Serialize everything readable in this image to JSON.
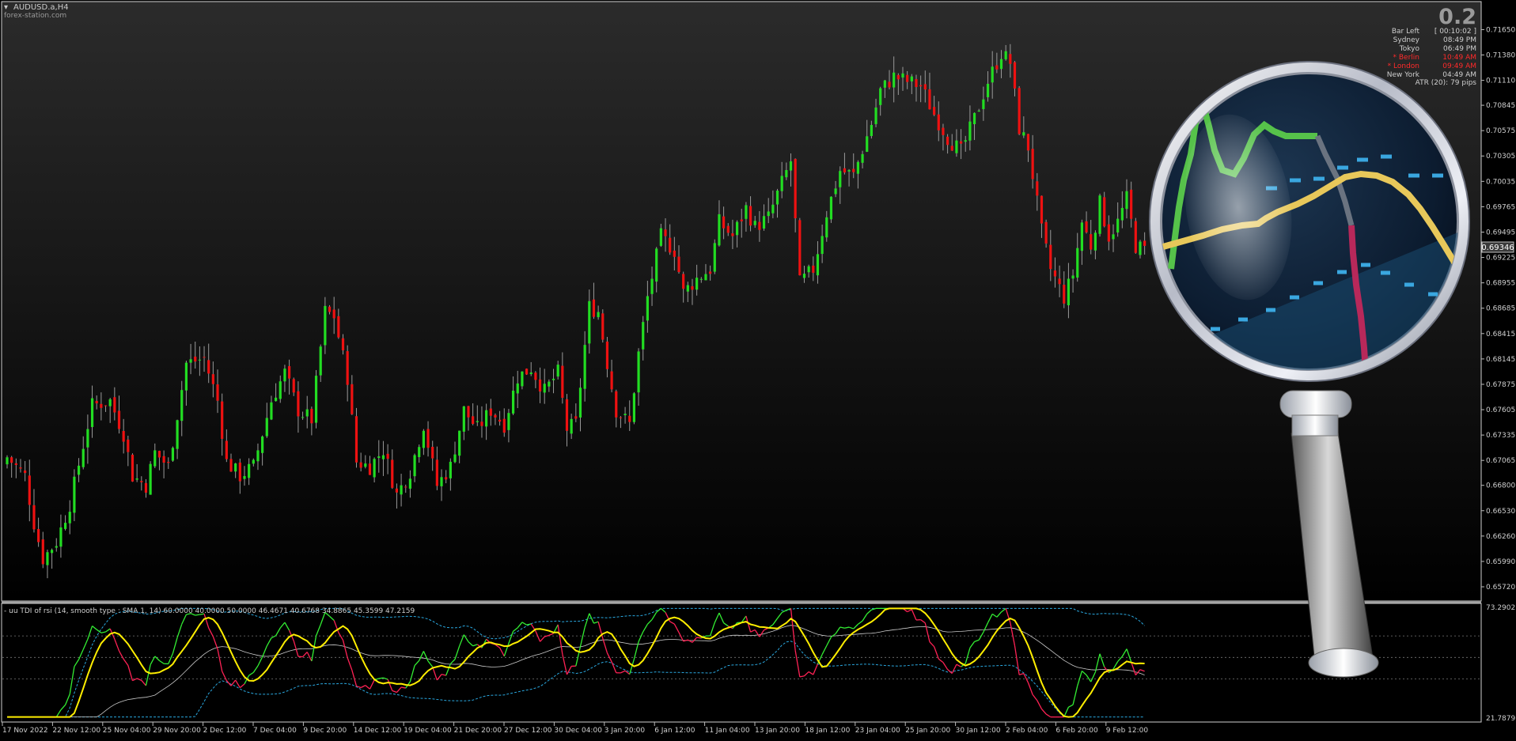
{
  "window": {
    "title": "AUDUSD.a,H4",
    "watermark": "forex-station.com"
  },
  "info_panel": {
    "spread": "0.2",
    "rows": [
      {
        "label": "Bar Left",
        "value": "[ 00:10:02 ]",
        "highlight": false
      },
      {
        "label": "Sydney",
        "value": "08:49 PM",
        "highlight": false
      },
      {
        "label": "Tokyo",
        "value": "06:49 PM",
        "highlight": false
      },
      {
        "label": "* Berlin",
        "value": "10:49 AM",
        "highlight": true
      },
      {
        "label": "* London",
        "value": "09:49 AM",
        "highlight": true
      },
      {
        "label": "New York",
        "value": "04:49 AM",
        "highlight": false
      }
    ],
    "atr": "ATR (20): 79 pips"
  },
  "indicator_header": "- uu TDI of rsi  (14, smooth type :  SMA 1, 14) 60.0000 40.0000 50.0000 46.4671 40.6768 34.8865 45.3599 47.2159",
  "colors": {
    "bull": "#22dd22",
    "bear": "#ee1111",
    "wick": "#9a9a9a",
    "tdi_yellow": "#ffee00",
    "tdi_band": "#2aa8e0",
    "tdi_green": "#33ee33",
    "tdi_red": "#ff2255",
    "tdi_white": "#cccccc"
  },
  "chart_data": [
    {
      "type": "candlestick",
      "symbol": "AUDUSD.a",
      "timeframe": "H4",
      "ylim": [
        0.6572,
        0.7178
      ],
      "current_price": "0.69346",
      "y_ticks": [
        "0.71650",
        "0.71380",
        "0.71110",
        "0.70845",
        "0.70575",
        "0.70305",
        "0.70035",
        "0.69765",
        "0.69495",
        "0.69225",
        "0.68955",
        "0.68685",
        "0.68415",
        "0.68145",
        "0.67875",
        "0.67605",
        "0.67335",
        "0.67065",
        "0.66800",
        "0.66530",
        "0.66260",
        "0.65990",
        "0.65720"
      ],
      "x_ticks": [
        "17 Nov 2022",
        "22 Nov 12:00",
        "25 Nov 04:00",
        "29 Nov 20:00",
        "2 Dec 12:00",
        "7 Dec 04:00",
        "9 Dec 20:00",
        "14 Dec 12:00",
        "19 Dec 04:00",
        "21 Dec 20:00",
        "27 Dec 12:00",
        "30 Dec 04:00",
        "3 Jan 20:00",
        "6 Jan 12:00",
        "11 Jan 04:00",
        "13 Jan 20:00",
        "18 Jan 12:00",
        "23 Jan 04:00",
        "25 Jan 20:00",
        "30 Jan 12:00",
        "2 Feb 04:00",
        "6 Feb 20:00",
        "9 Feb 12:00"
      ],
      "close_path": [
        [
          0,
          0.671
        ],
        [
          4,
          0.669
        ],
        [
          6,
          0.664
        ],
        [
          8,
          0.6602
        ],
        [
          11,
          0.662
        ],
        [
          14,
          0.666
        ],
        [
          19,
          0.6765
        ],
        [
          23,
          0.677
        ],
        [
          26,
          0.6735
        ],
        [
          28,
          0.669
        ],
        [
          31,
          0.668
        ],
        [
          33,
          0.6715
        ],
        [
          36,
          0.67
        ],
        [
          40,
          0.681
        ],
        [
          44,
          0.6815
        ],
        [
          47,
          0.677
        ],
        [
          49,
          0.6705
        ],
        [
          52,
          0.669
        ],
        [
          55,
          0.67
        ],
        [
          59,
          0.677
        ],
        [
          62,
          0.68
        ],
        [
          65,
          0.676
        ],
        [
          68,
          0.675
        ],
        [
          71,
          0.6865
        ],
        [
          73,
          0.686
        ],
        [
          76,
          0.6795
        ],
        [
          78,
          0.6705
        ],
        [
          81,
          0.67
        ],
        [
          84,
          0.6718
        ],
        [
          87,
          0.667
        ],
        [
          90,
          0.6695
        ],
        [
          93,
          0.6745
        ],
        [
          96,
          0.668
        ],
        [
          99,
          0.67
        ],
        [
          102,
          0.676
        ],
        [
          105,
          0.674
        ],
        [
          108,
          0.676
        ],
        [
          111,
          0.6745
        ],
        [
          114,
          0.6795
        ],
        [
          117,
          0.6805
        ],
        [
          120,
          0.678
        ],
        [
          123,
          0.68
        ],
        [
          125,
          0.674
        ],
        [
          127,
          0.6745
        ],
        [
          130,
          0.687
        ],
        [
          132,
          0.6865
        ],
        [
          134,
          0.681
        ],
        [
          136,
          0.676
        ],
        [
          139,
          0.6745
        ],
        [
          141,
          0.682
        ],
        [
          143,
          0.688
        ],
        [
          146,
          0.6945
        ],
        [
          149,
          0.693
        ],
        [
          151,
          0.6885
        ],
        [
          154,
          0.69
        ],
        [
          157,
          0.691
        ],
        [
          159,
          0.696
        ],
        [
          162,
          0.6945
        ],
        [
          165,
          0.6975
        ],
        [
          167,
          0.6955
        ],
        [
          170,
          0.6965
        ],
        [
          172,
          0.699
        ],
        [
          175,
          0.7025
        ],
        [
          177,
          0.6895
        ],
        [
          180,
          0.691
        ],
        [
          183,
          0.697
        ],
        [
          186,
          0.7015
        ],
        [
          189,
          0.701
        ],
        [
          193,
          0.7065
        ],
        [
          195,
          0.71
        ],
        [
          198,
          0.7115
        ],
        [
          201,
          0.711
        ],
        [
          204,
          0.7105
        ],
        [
          207,
          0.7075
        ],
        [
          210,
          0.705
        ],
        [
          213,
          0.7035
        ],
        [
          216,
          0.707
        ],
        [
          219,
          0.711
        ],
        [
          222,
          0.714
        ],
        [
          224,
          0.713
        ],
        [
          226,
          0.706
        ],
        [
          228,
          0.704
        ],
        [
          231,
          0.695
        ],
        [
          233,
          0.691
        ],
        [
          236,
          0.688
        ],
        [
          238,
          0.6905
        ],
        [
          240,
          0.696
        ],
        [
          242,
          0.6935
        ],
        [
          244,
          0.698
        ],
        [
          246,
          0.6945
        ],
        [
          248,
          0.696
        ],
        [
          250,
          0.6985
        ],
        [
          252,
          0.6935
        ],
        [
          254,
          0.693
        ]
      ],
      "candle_count": 255
    },
    {
      "type": "line",
      "name": "TDI of rsi",
      "ylim": [
        21.7879,
        73.2902
      ],
      "y_ticks": [
        "73.2902",
        "21.7879"
      ],
      "levels": [
        60,
        50,
        40
      ],
      "series_desc": [
        "rsi price line (green above / red below)",
        "signal line (yellow)",
        "volatility bands (dashed blue)",
        "market base (white)"
      ]
    }
  ],
  "magnifier": {
    "icon": "magnifier-icon"
  }
}
